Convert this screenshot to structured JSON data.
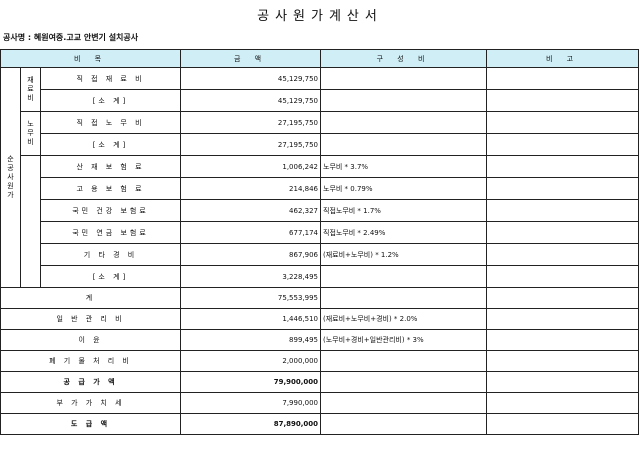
{
  "title": "공사원가계산서",
  "project": "공사명 : 혜원여중.고교 안변기 설치공사",
  "headers": {
    "item": "비 목",
    "amount": "금 액",
    "composition": "구 성 비",
    "remark": "비 고"
  },
  "groups": {
    "pure": "순공사원가",
    "material": "재료비",
    "labor": "노무비"
  },
  "rows": {
    "direct_material": {
      "label": "직 접 재 료 비",
      "amount": "45,129,750",
      "note": ""
    },
    "material_subtotal": {
      "label": "[소 계]",
      "amount": "45,129,750",
      "note": ""
    },
    "direct_labor": {
      "label": "직 접 노 무 비",
      "amount": "27,195,750",
      "note": ""
    },
    "labor_subtotal": {
      "label": "[소 계]",
      "amount": "27,195,750",
      "note": ""
    },
    "industrial_accident": {
      "label": "산 재 보 험 료",
      "amount": "1,006,242",
      "note": "노무비 * 3.7%"
    },
    "employment_insurance": {
      "label": "고 용 보 험 료",
      "amount": "214,846",
      "note": "노무비 * 0.79%"
    },
    "health_insurance": {
      "label": "국민 건강 보험료",
      "amount": "462,327",
      "note": "직접노무비 * 1.7%"
    },
    "pension_insurance": {
      "label": "국민 연금 보험료",
      "amount": "677,174",
      "note": "직접노무비 * 2.49%"
    },
    "other_expenses": {
      "label": "기 타 경 비",
      "amount": "867,906",
      "note": "(재료비+노무비) * 1.2%"
    },
    "expense_subtotal": {
      "label": "[소 계]",
      "amount": "3,228,495",
      "note": ""
    },
    "total": {
      "label": "계",
      "amount": "75,553,995",
      "note": ""
    },
    "general_admin": {
      "label": "일 반 관 리 비",
      "amount": "1,446,510",
      "note": "(재료비+노무비+경비) * 2.0%"
    },
    "profit": {
      "label": "이 윤",
      "amount": "899,495",
      "note": "(노무비+경비+일반관리비) * 3%"
    },
    "waste_disposal": {
      "label": "폐 기 물 처 리 비",
      "amount": "2,000,000",
      "note": ""
    },
    "supply_price": {
      "label": "공 급 가 액",
      "amount": "79,900,000",
      "note": ""
    },
    "vat": {
      "label": "부 가 가 치 세",
      "amount": "7,990,000",
      "note": ""
    },
    "grand_total": {
      "label": "도 급 액",
      "amount": "87,890,000",
      "note": ""
    }
  }
}
